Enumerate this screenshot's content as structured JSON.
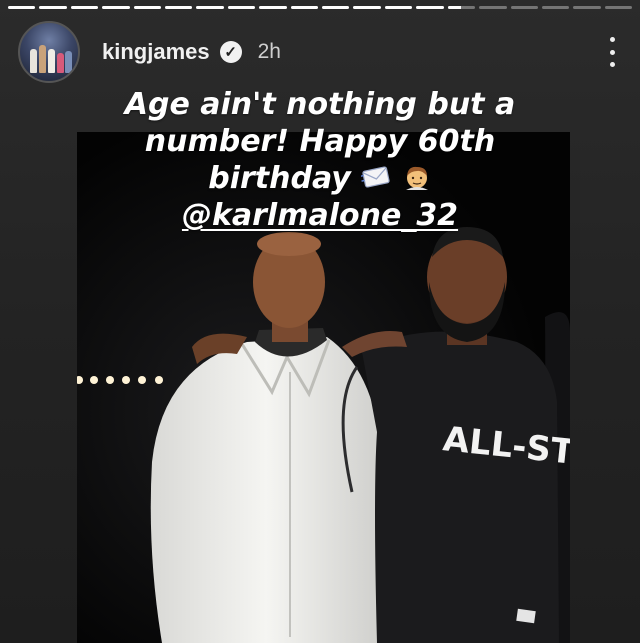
{
  "story": {
    "progress": [
      1,
      1,
      1,
      1,
      1,
      1,
      1,
      1,
      1,
      1,
      1,
      1,
      1,
      1,
      0.5,
      0,
      0,
      0,
      0,
      0
    ]
  },
  "header": {
    "username": "kingjames",
    "verified_glyph": "✓",
    "timestamp": "2h",
    "avatar_icon": "profile-avatar",
    "more_icon": "more-vertical-icon"
  },
  "caption": {
    "line1": "Age ain't nothing but a",
    "line2": "number! Happy 60th",
    "line3": "birthday",
    "mention": "@karlmalone_32",
    "emojis": [
      "envelope-icon",
      "man-icon"
    ]
  },
  "photo": {
    "shirt_text": "ALL-STAR",
    "colors": {
      "white_shirt": "#eeeeec",
      "black_shirt": "#1b1b1d",
      "background": "#050505"
    }
  }
}
